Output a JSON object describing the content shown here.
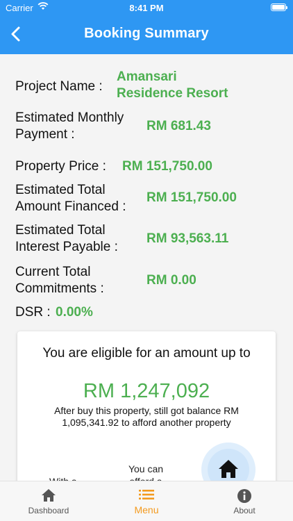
{
  "status_bar": {
    "carrier": "Carrier",
    "time": "8:41 PM"
  },
  "header": {
    "title": "Booking Summary"
  },
  "summary": {
    "project_label": "Project Name :",
    "project_value_line1": "Amansari",
    "project_value_line2": "Residence Resort",
    "monthly_label_line1": "Estimated Monthly",
    "monthly_label_line2": "Payment :",
    "monthly_value": "RM 681.43",
    "price_label": "Property Price :",
    "price_value": "RM 151,750.00",
    "financed_label_line1": "Estimated Total",
    "financed_label_line2": "Amount Financed :",
    "financed_value": "RM 151,750.00",
    "interest_label_line1": "Estimated Total",
    "interest_label_line2": "Interest Payable :",
    "interest_value": "RM 93,563.11",
    "commit_label_line1": "Current Total",
    "commit_label_line2": "Commitments :",
    "commit_value": "RM 0.00",
    "dsr_label": "DSR :",
    "dsr_value": "0.00%"
  },
  "eligibility_card": {
    "heading": "You are eligible for an amount up to",
    "amount": "RM 1,247,092",
    "balance_note": "After buy this property, still got balance RM 1,095,341.92 to afford another property",
    "with_label": "With a",
    "afford_label": "You can afford a"
  },
  "tabbar": {
    "tabs": [
      {
        "label": "Dashboard",
        "icon": "home-icon"
      },
      {
        "label": "Menu",
        "icon": "menu-icon"
      },
      {
        "label": "About",
        "icon": "info-icon"
      }
    ],
    "active_index": 1
  },
  "colors": {
    "primary": "#2e97f3",
    "value_green": "#4caf50",
    "active_tab": "#f39a1e"
  }
}
